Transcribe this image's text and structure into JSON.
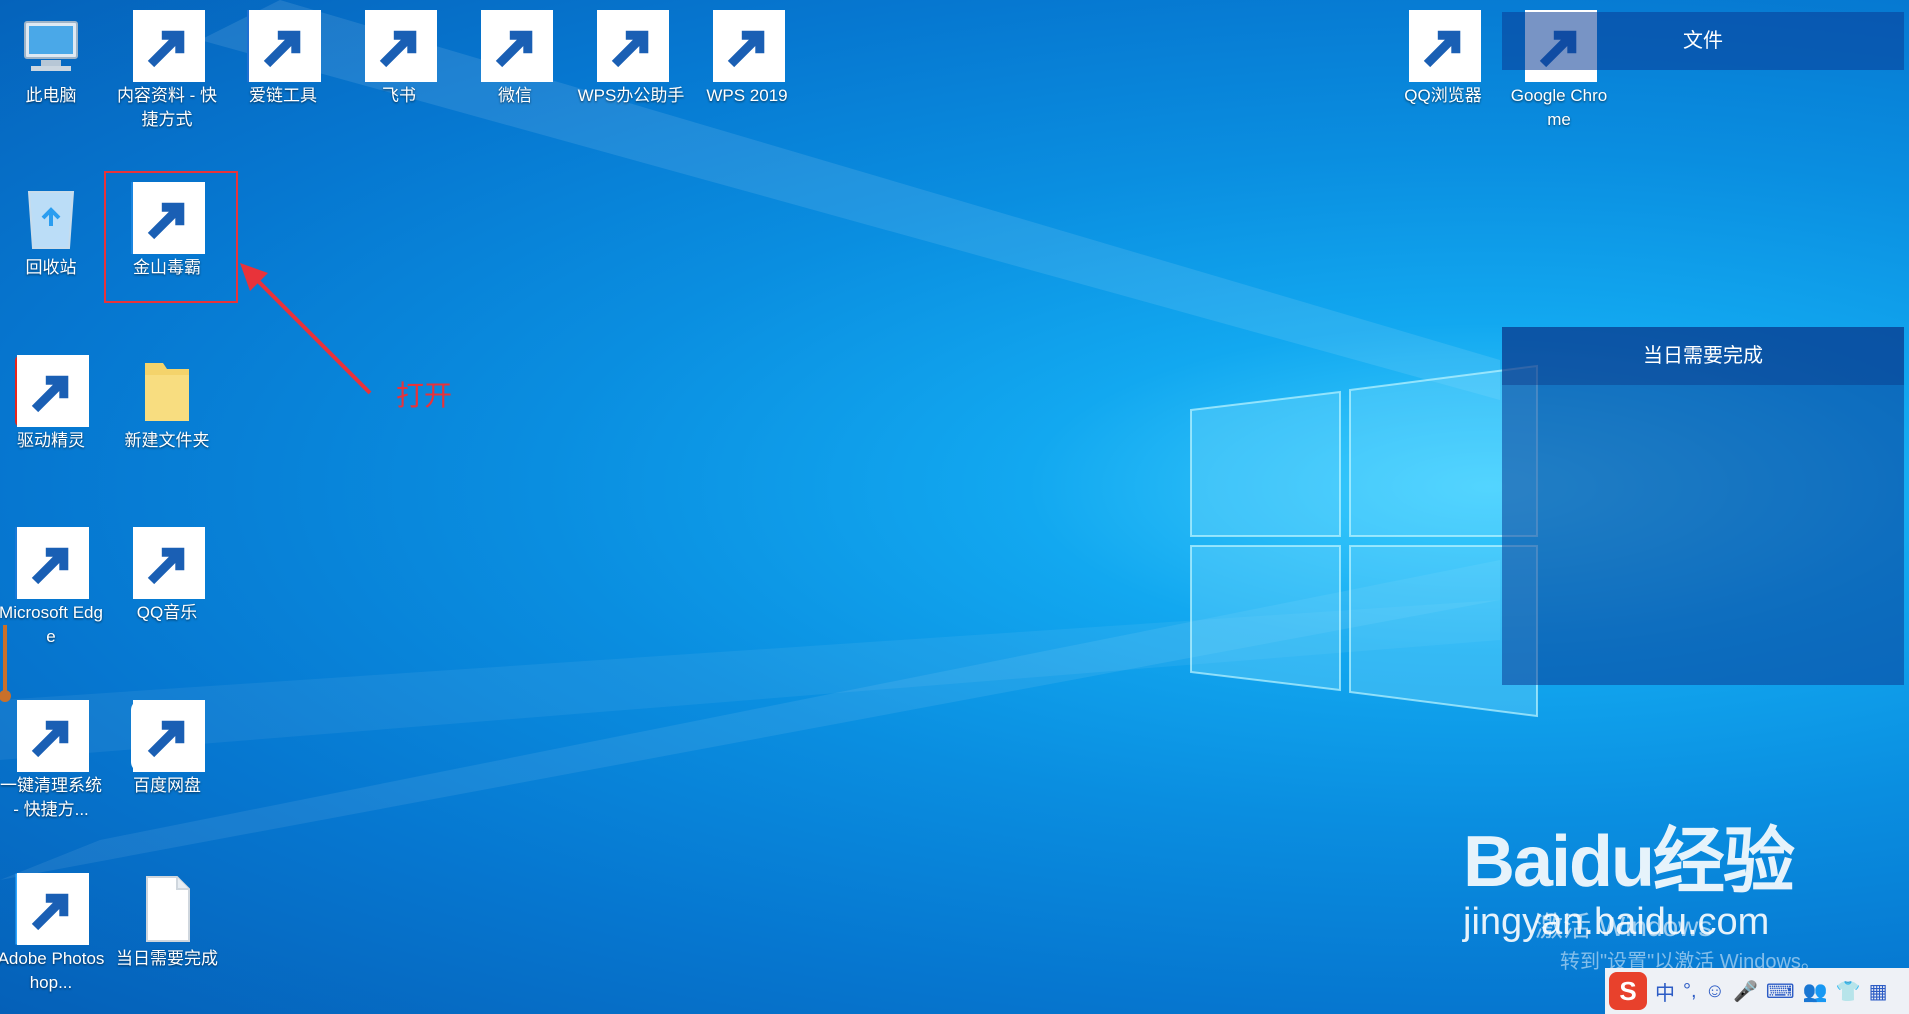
{
  "desktop": {
    "icons": [
      {
        "label": "此电脑",
        "icon": "computer-icon"
      },
      {
        "label": "内容资料 - 快捷方式",
        "icon": "folder-icon"
      },
      {
        "label": "爱链工具",
        "icon": "link-tool-icon"
      },
      {
        "label": "飞书",
        "icon": "feishu-icon"
      },
      {
        "label": "微信",
        "icon": "wechat-icon"
      },
      {
        "label": "WPS办公助手",
        "icon": "wps-assistant-icon"
      },
      {
        "label": "WPS 2019",
        "icon": "wps-icon"
      },
      {
        "label": "QQ浏览器",
        "icon": "qq-browser-icon"
      },
      {
        "label": "Google Chrome",
        "icon": "chrome-icon"
      },
      {
        "label": "回收站",
        "icon": "recycle-bin-icon"
      },
      {
        "label": "金山毒霸",
        "icon": "kingsoft-antivirus-icon"
      },
      {
        "label": "驱动精灵",
        "icon": "driver-genius-icon"
      },
      {
        "label": "新建文件夹",
        "icon": "folder-icon"
      },
      {
        "label": "Microsoft Edge",
        "icon": "edge-icon"
      },
      {
        "label": "QQ音乐",
        "icon": "qq-music-icon"
      },
      {
        "label": "一键清理系统 - 快捷方...",
        "icon": "cleanup-icon"
      },
      {
        "label": "百度网盘",
        "icon": "baidu-netdisk-icon"
      },
      {
        "label": "Adobe Photoshop...",
        "icon": "photoshop-icon"
      },
      {
        "label": "当日需要完成",
        "icon": "document-icon"
      }
    ]
  },
  "annotation": {
    "text": "打开"
  },
  "widgets": {
    "files": {
      "title": "文件"
    },
    "todo": {
      "title": "当日需要完成"
    }
  },
  "watermark": {
    "logo": "Baidu经验",
    "url": "jingyan.baidu.com",
    "activate": "激活 Windows",
    "activate_sub": "转到\"设置\"以激活 Windows。"
  },
  "ime": {
    "items": [
      "中",
      "°,",
      "☺",
      "🎤",
      "⌨",
      "👥",
      "👕",
      "▦"
    ]
  },
  "colors": {
    "desktop": "#0a8ee0",
    "annotation": "#e8333a"
  }
}
